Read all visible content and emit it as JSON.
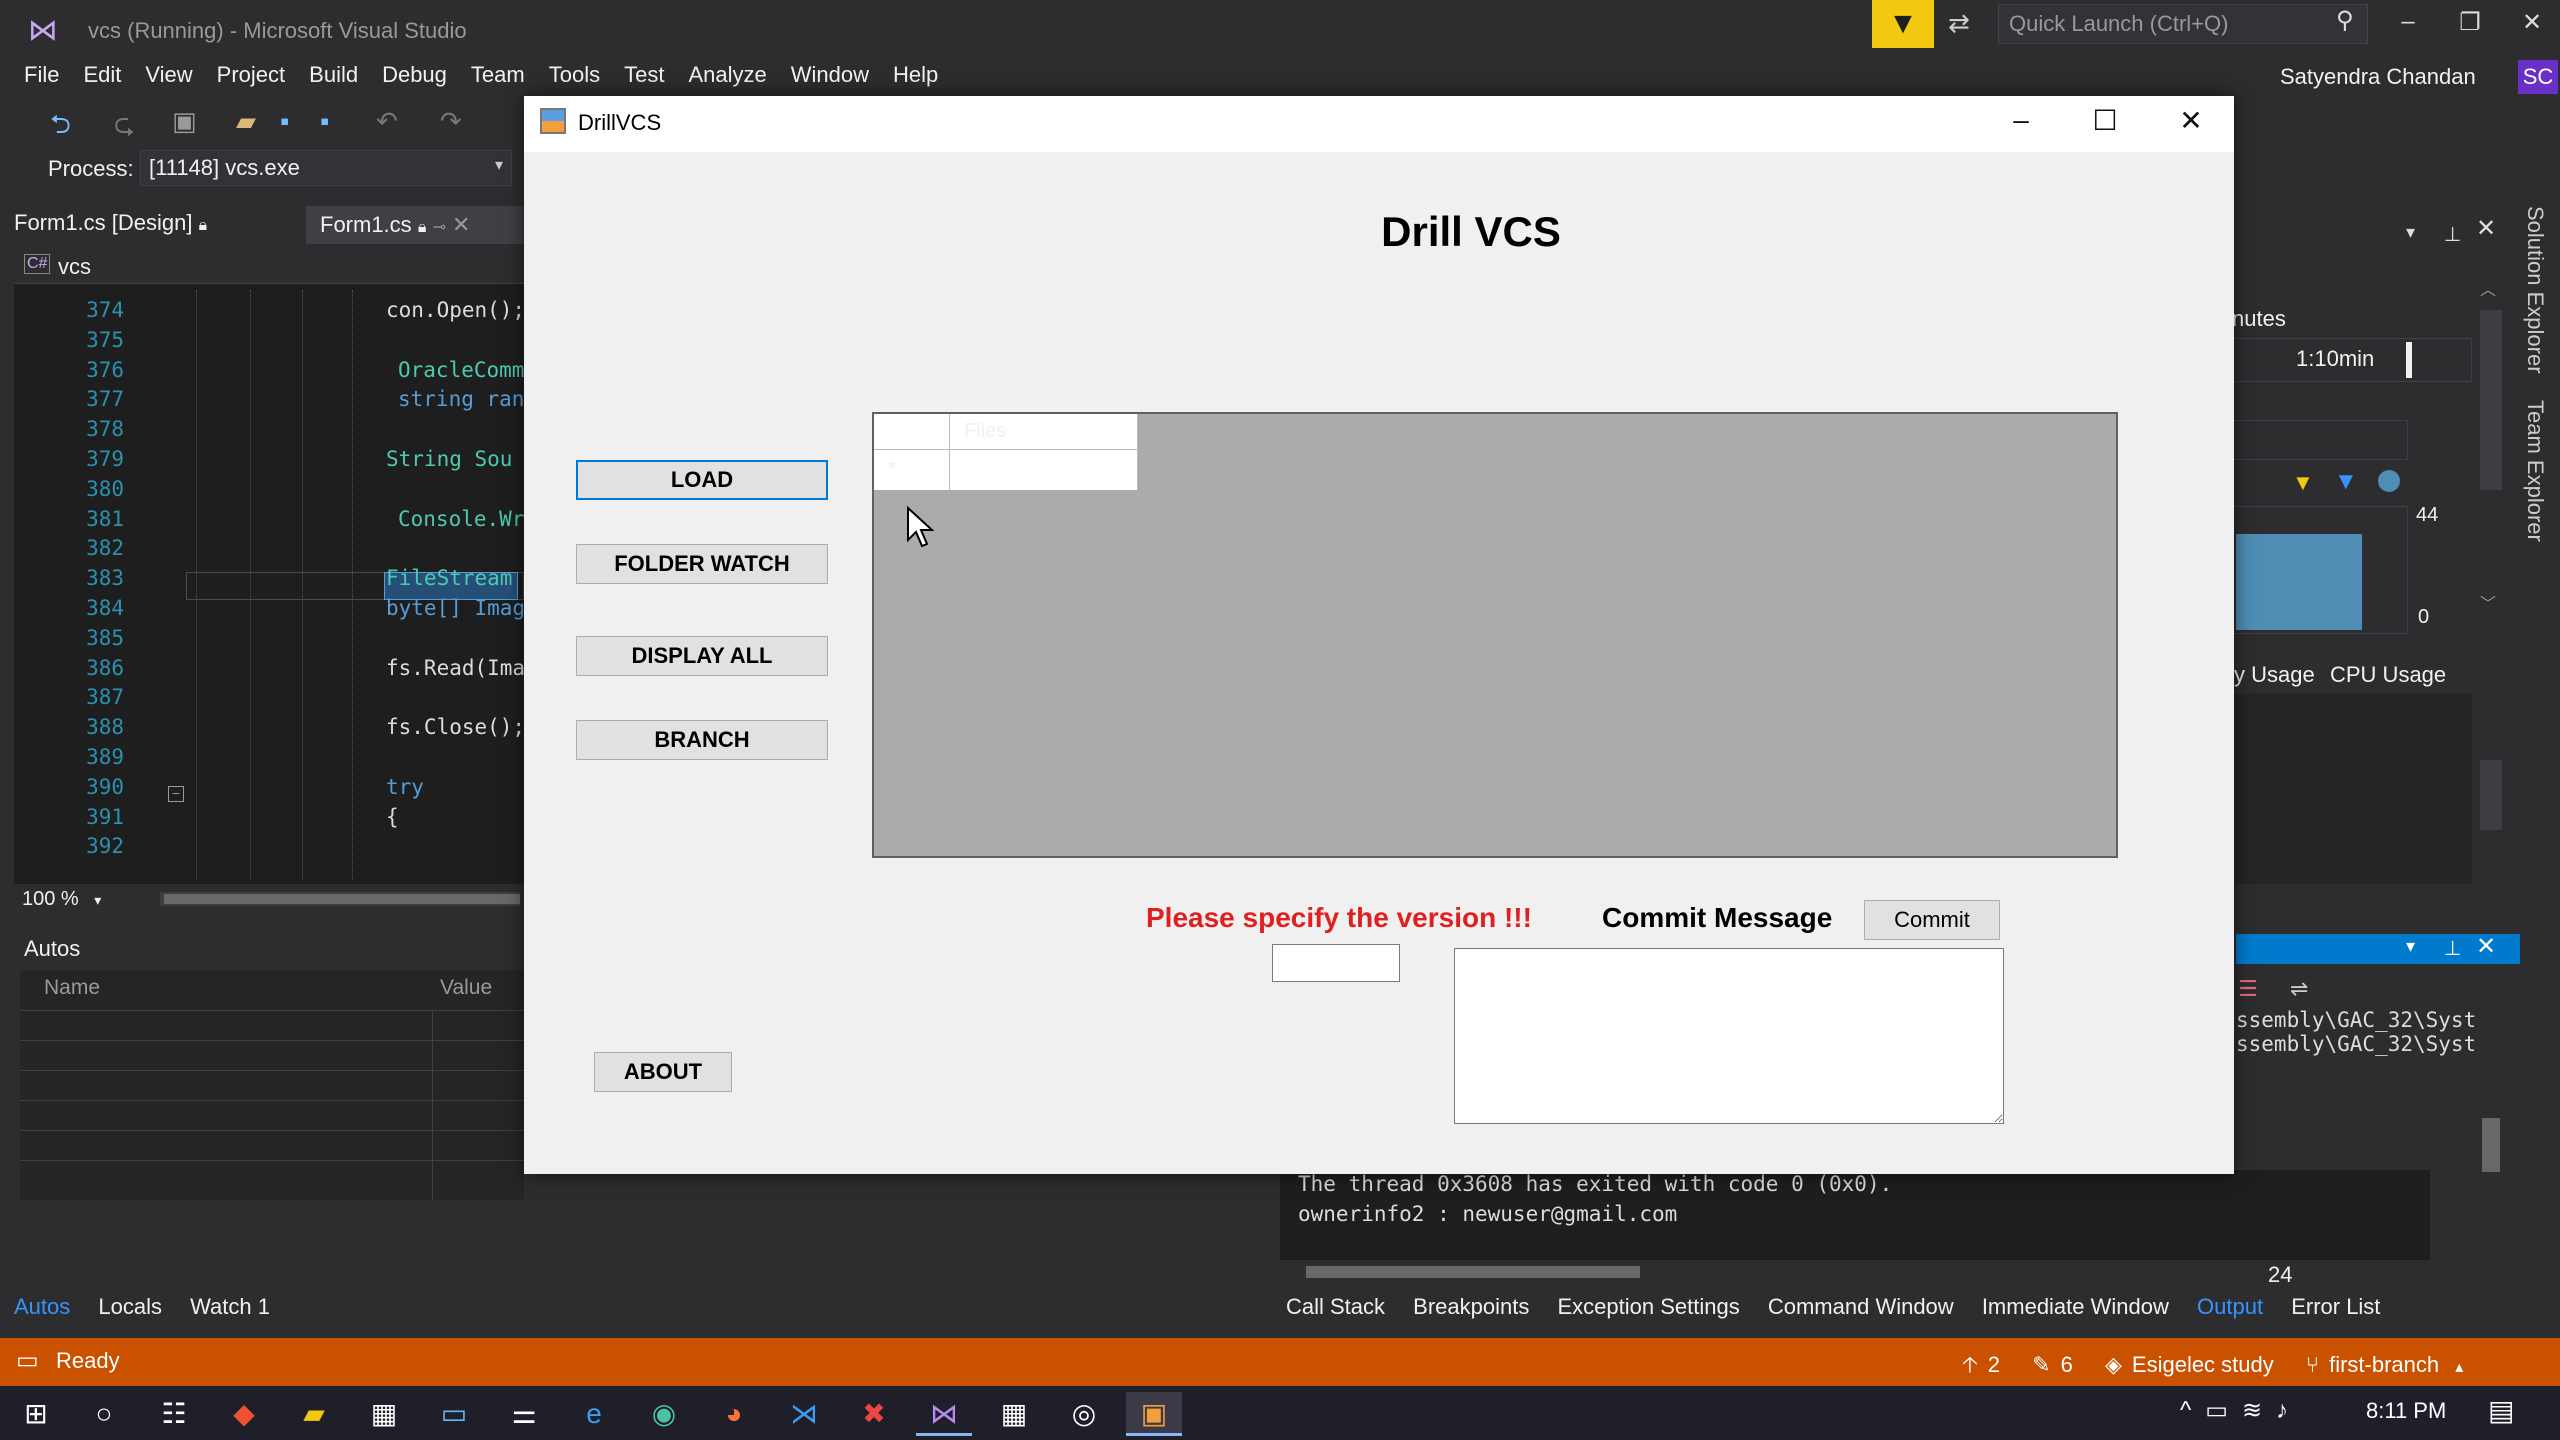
{
  "vs": {
    "title": "vcs (Running) - Microsoft Visual Studio",
    "quick_launch_placeholder": "Quick Launch (Ctrl+Q)",
    "user_name": "Satyendra Chandan",
    "user_initials": "SC",
    "menu": [
      "File",
      "Edit",
      "View",
      "Project",
      "Build",
      "Debug",
      "Team",
      "Tools",
      "Test",
      "Analyze",
      "Window",
      "Help"
    ],
    "process_label": "Process:",
    "process_value": "[11148] vcs.exe",
    "doc_tabs": [
      "Form1.cs [Design]",
      "Form1.cs"
    ],
    "nav_class": "vcs",
    "zoom": "100 %"
  },
  "code": {
    "lines": [
      {
        "n": "374",
        "text": "con.Open();",
        "indent": 0
      },
      {
        "n": "375",
        "text": "",
        "indent": 0
      },
      {
        "n": "376",
        "text": "OracleComm",
        "indent": 1
      },
      {
        "n": "377",
        "text": "string ran",
        "indent": 1
      },
      {
        "n": "378",
        "text": "",
        "indent": 0
      },
      {
        "n": "379",
        "text": "String Sou",
        "indent": 0
      },
      {
        "n": "380",
        "text": "",
        "indent": 0
      },
      {
        "n": "381",
        "text": "Console.Wr",
        "indent": 1
      },
      {
        "n": "382",
        "text": "",
        "indent": 0
      },
      {
        "n": "383",
        "text": "FileStream",
        "indent": 0
      },
      {
        "n": "384",
        "text": "byte[] Imag",
        "indent": 0
      },
      {
        "n": "385",
        "text": "",
        "indent": 0
      },
      {
        "n": "386",
        "text": "fs.Read(Ima",
        "indent": 0
      },
      {
        "n": "387",
        "text": "",
        "indent": 0
      },
      {
        "n": "388",
        "text": "fs.Close();",
        "indent": 0
      },
      {
        "n": "389",
        "text": "",
        "indent": 0
      },
      {
        "n": "390",
        "text": "try",
        "indent": 0
      },
      {
        "n": "391",
        "text": "{",
        "indent": 0
      },
      {
        "n": "392",
        "text": "",
        "indent": 0
      }
    ]
  },
  "autos": {
    "title": "Autos",
    "col_name": "Name",
    "col_value": "Value",
    "tabs": [
      "Autos",
      "Locals",
      "Watch 1"
    ]
  },
  "diagnostics": {
    "minutes_label": "nutes",
    "time": "1:10min",
    "max_value": "44",
    "min_value": "0",
    "tab_memory": "y Usage",
    "tab_cpu": "CPU Usage",
    "side_tabs": [
      "Solution Explorer",
      "Team Explorer"
    ]
  },
  "output": {
    "lines": [
      "The thread 0x3608 has exited with code 0 (0x0).",
      "ownerinfo2 : newuser@gmail.com"
    ],
    "right_lines": [
      "ssembly\\GAC_32\\Syst",
      "ssembly\\GAC_32\\Syst"
    ],
    "col_number": "24",
    "debug_tabs": [
      "Call Stack",
      "Breakpoints",
      "Exception Settings",
      "Command Window",
      "Immediate Window",
      "Output",
      "Error List"
    ]
  },
  "status": {
    "text": "Ready",
    "arrows": "2",
    "edits": "6",
    "repo": "Esigelec study",
    "branch": "first-branch"
  },
  "taskbar": {
    "time": "8:11 PM"
  },
  "drill": {
    "window_title": "DrillVCS",
    "heading": "Drill VCS",
    "buttons": {
      "load": "LOAD",
      "folder_watch": "FOLDER WATCH",
      "display_all": "DISPLAY ALL",
      "branch": "BRANCH",
      "about": "ABOUT",
      "commit": "Commit"
    },
    "grid_column": "Files",
    "grid_new_row_marker": "*",
    "version_warning": "Please specify the version !!!",
    "commit_label": "Commit Message",
    "version_value": "",
    "commit_message_value": ""
  }
}
